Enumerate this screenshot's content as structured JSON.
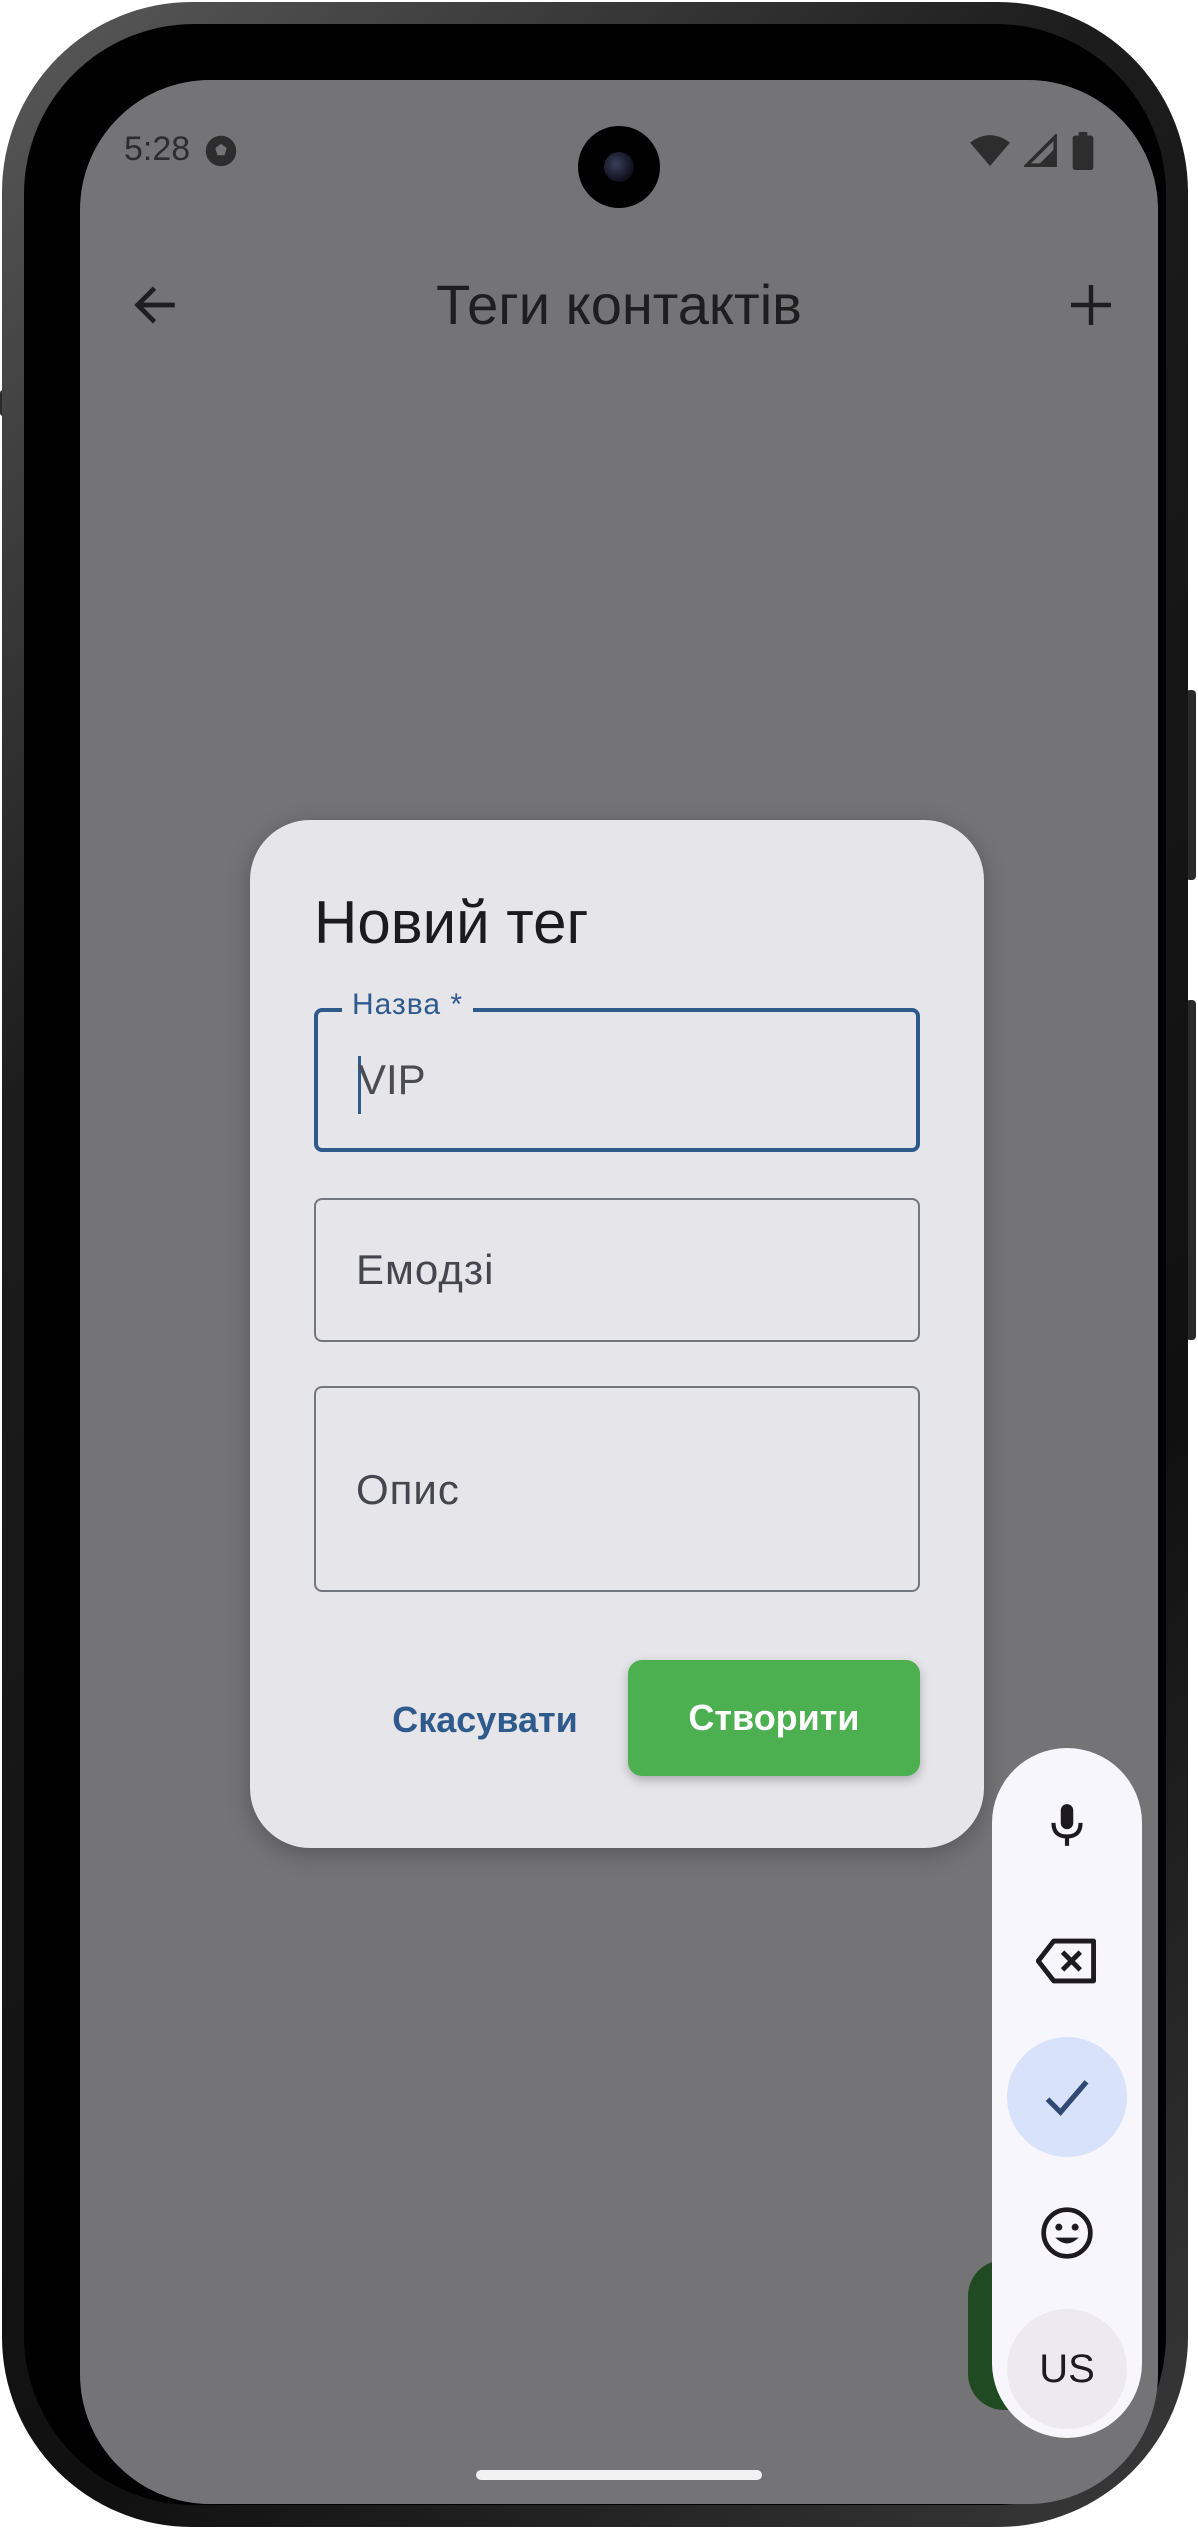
{
  "status_bar": {
    "time": "5:28",
    "app_icon": "soccer-ball-icon",
    "icons": [
      "wifi-icon",
      "signal-icon",
      "battery-icon"
    ]
  },
  "top_bar": {
    "title": "Теги контактів",
    "back_icon": "arrow-left-icon",
    "add_icon": "plus-icon"
  },
  "dialog": {
    "title": "Новий тег",
    "name_field": {
      "label": "Назва *",
      "value": "VIP"
    },
    "emoji_field": {
      "placeholder": "Емодзі"
    },
    "description_field": {
      "placeholder": "Опис"
    },
    "cancel_label": "Скасувати",
    "create_label": "Створити"
  },
  "keyboard_toolbar": {
    "items": [
      {
        "icon": "microphone-icon"
      },
      {
        "icon": "backspace-icon"
      },
      {
        "icon": "check-icon",
        "active": true
      },
      {
        "icon": "emoji-icon"
      },
      {
        "label": "US"
      }
    ]
  },
  "colors": {
    "scrim": "#747476",
    "dialog_bg": "#e5e5ea",
    "accent": "#2f5a8c",
    "create_button": "#4caf50"
  }
}
